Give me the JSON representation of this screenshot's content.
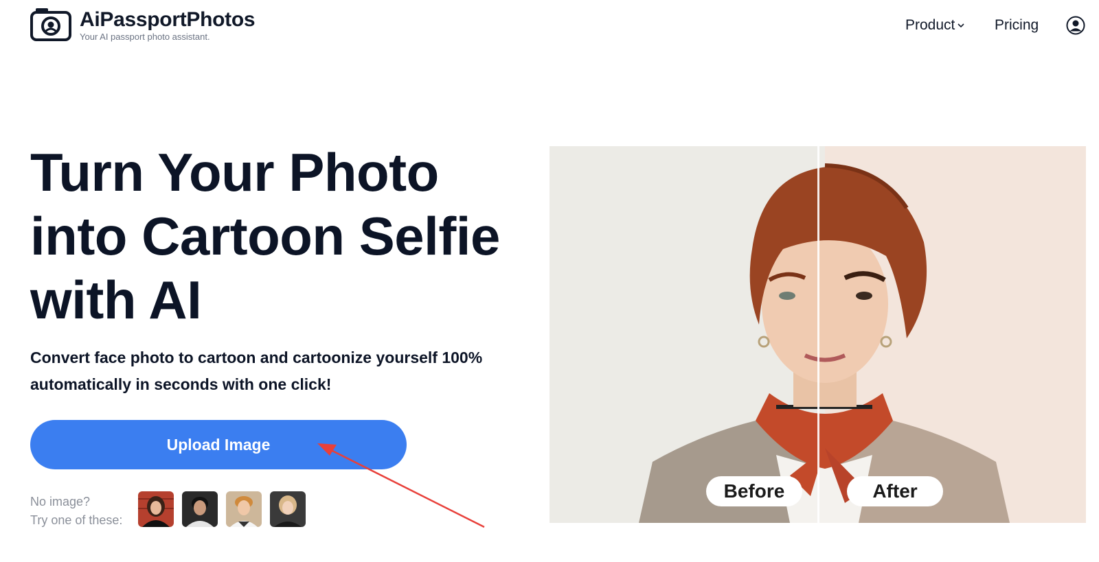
{
  "brand": {
    "name": "AiPassportPhotos",
    "tagline": "Your AI passport photo assistant."
  },
  "nav": {
    "product_label": "Product",
    "pricing_label": "Pricing"
  },
  "hero": {
    "headline_line1": "Turn Your Photo",
    "headline_line2": "into Cartoon Selfie",
    "headline_line3": "with AI",
    "subtitle_line1": "Convert face photo to cartoon and cartoonize yourself 100%",
    "subtitle_line2": "automatically in seconds with one click!",
    "upload_label": "Upload Image",
    "samples_line1": "No image?",
    "samples_line2": "Try one of these:"
  },
  "compare": {
    "before_label": "Before",
    "after_label": "After"
  },
  "colors": {
    "accent": "#3b7ef0",
    "text": "#0c1426",
    "muted": "#8a8f99",
    "annotation": "#e8403a"
  }
}
